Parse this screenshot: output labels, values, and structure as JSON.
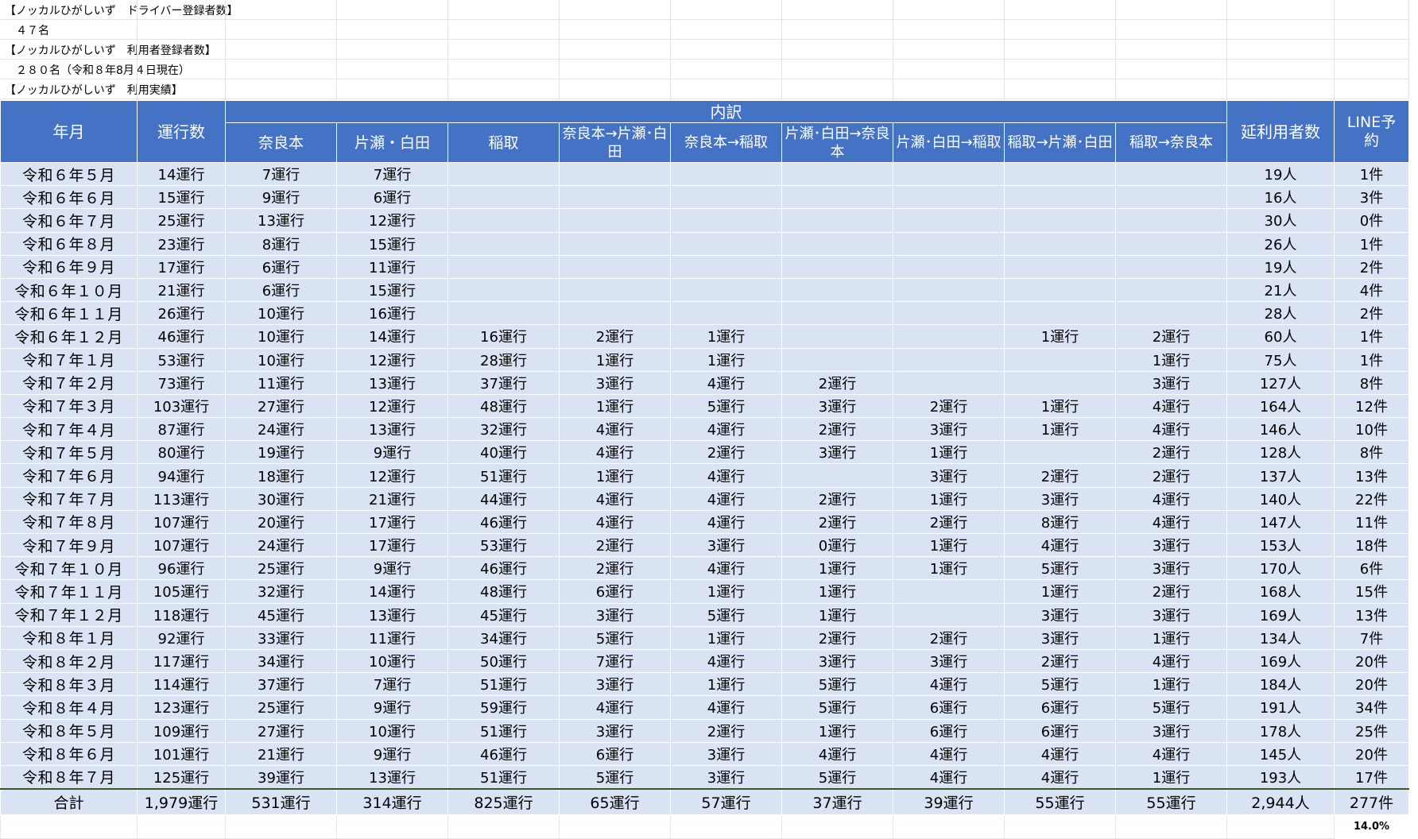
{
  "info": {
    "driver_label": "【ノッカルひがしいず　ドライバー登録者数】",
    "driver_value": "４７名",
    "user_label": "【ノッカルひがしいず　利用者登録者数】",
    "user_value": "２８０名（令和８年8月４日現在）",
    "results_label": "【ノッカルひがしいず　利用実績】"
  },
  "table": {
    "headers": {
      "year_month": "年月",
      "runs": "運行数",
      "breakdown": "内訳",
      "total_users": "延利用者数",
      "line_reservation": "LINE予約",
      "routes": [
        "奈良本",
        "片瀬・白田",
        "稲取",
        "奈良本→片瀬･白田",
        "奈良本→稲取",
        "片瀬･白田→奈良本",
        "片瀬･白田→稲取",
        "稲取→片瀬･白田",
        "稲取→奈良本"
      ]
    },
    "rows": [
      [
        "令和６年５月",
        "14運行",
        "7運行",
        "7運行",
        "",
        "",
        "",
        "",
        "",
        "",
        "",
        "19人",
        "1件"
      ],
      [
        "令和６年６月",
        "15運行",
        "9運行",
        "6運行",
        "",
        "",
        "",
        "",
        "",
        "",
        "",
        "16人",
        "3件"
      ],
      [
        "令和６年７月",
        "25運行",
        "13運行",
        "12運行",
        "",
        "",
        "",
        "",
        "",
        "",
        "",
        "30人",
        "0件"
      ],
      [
        "令和６年８月",
        "23運行",
        "8運行",
        "15運行",
        "",
        "",
        "",
        "",
        "",
        "",
        "",
        "26人",
        "1件"
      ],
      [
        "令和６年９月",
        "17運行",
        "6運行",
        "11運行",
        "",
        "",
        "",
        "",
        "",
        "",
        "",
        "19人",
        "2件"
      ],
      [
        "令和６年１０月",
        "21運行",
        "6運行",
        "15運行",
        "",
        "",
        "",
        "",
        "",
        "",
        "",
        "21人",
        "4件"
      ],
      [
        "令和６年１１月",
        "26運行",
        "10運行",
        "16運行",
        "",
        "",
        "",
        "",
        "",
        "",
        "",
        "28人",
        "2件"
      ],
      [
        "令和６年１２月",
        "46運行",
        "10運行",
        "14運行",
        "16運行",
        "2運行",
        "1運行",
        "",
        "",
        "1運行",
        "2運行",
        "60人",
        "1件"
      ],
      [
        "令和７年１月",
        "53運行",
        "10運行",
        "12運行",
        "28運行",
        "1運行",
        "1運行",
        "",
        "",
        "",
        "1運行",
        "75人",
        "1件"
      ],
      [
        "令和７年２月",
        "73運行",
        "11運行",
        "13運行",
        "37運行",
        "3運行",
        "4運行",
        "2運行",
        "",
        "",
        "3運行",
        "127人",
        "8件"
      ],
      [
        "令和７年３月",
        "103運行",
        "27運行",
        "12運行",
        "48運行",
        "1運行",
        "5運行",
        "3運行",
        "2運行",
        "1運行",
        "4運行",
        "164人",
        "12件"
      ],
      [
        "令和７年４月",
        "87運行",
        "24運行",
        "13運行",
        "32運行",
        "4運行",
        "4運行",
        "2運行",
        "3運行",
        "1運行",
        "4運行",
        "146人",
        "10件"
      ],
      [
        "令和７年５月",
        "80運行",
        "19運行",
        "9運行",
        "40運行",
        "4運行",
        "2運行",
        "3運行",
        "1運行",
        "",
        "2運行",
        "128人",
        "8件"
      ],
      [
        "令和７年６月",
        "94運行",
        "18運行",
        "12運行",
        "51運行",
        "1運行",
        "4運行",
        "",
        "3運行",
        "2運行",
        "2運行",
        "137人",
        "13件"
      ],
      [
        "令和７年７月",
        "113運行",
        "30運行",
        "21運行",
        "44運行",
        "4運行",
        "4運行",
        "2運行",
        "1運行",
        "3運行",
        "4運行",
        "140人",
        "22件"
      ],
      [
        "令和７年８月",
        "107運行",
        "20運行",
        "17運行",
        "46運行",
        "4運行",
        "4運行",
        "2運行",
        "2運行",
        "8運行",
        "4運行",
        "147人",
        "11件"
      ],
      [
        "令和７年９月",
        "107運行",
        "24運行",
        "17運行",
        "53運行",
        "2運行",
        "3運行",
        "0運行",
        "1運行",
        "4運行",
        "3運行",
        "153人",
        "18件"
      ],
      [
        "令和７年１０月",
        "96運行",
        "25運行",
        "9運行",
        "46運行",
        "2運行",
        "4運行",
        "1運行",
        "1運行",
        "5運行",
        "3運行",
        "170人",
        "6件"
      ],
      [
        "令和７年１１月",
        "105運行",
        "32運行",
        "14運行",
        "48運行",
        "6運行",
        "1運行",
        "1運行",
        "",
        "1運行",
        "2運行",
        "168人",
        "15件"
      ],
      [
        "令和７年１２月",
        "118運行",
        "45運行",
        "13運行",
        "45運行",
        "3運行",
        "5運行",
        "1運行",
        "",
        "3運行",
        "3運行",
        "169人",
        "13件"
      ],
      [
        "令和８年１月",
        "92運行",
        "33運行",
        "11運行",
        "34運行",
        "5運行",
        "1運行",
        "2運行",
        "2運行",
        "3運行",
        "1運行",
        "134人",
        "7件"
      ],
      [
        "令和８年２月",
        "117運行",
        "34運行",
        "10運行",
        "50運行",
        "7運行",
        "4運行",
        "3運行",
        "3運行",
        "2運行",
        "4運行",
        "169人",
        "20件"
      ],
      [
        "令和８年３月",
        "114運行",
        "37運行",
        "7運行",
        "51運行",
        "3運行",
        "1運行",
        "5運行",
        "4運行",
        "5運行",
        "1運行",
        "184人",
        "20件"
      ],
      [
        "令和８年４月",
        "123運行",
        "25運行",
        "9運行",
        "59運行",
        "4運行",
        "4運行",
        "5運行",
        "6運行",
        "6運行",
        "5運行",
        "191人",
        "34件"
      ],
      [
        "令和８年５月",
        "109運行",
        "27運行",
        "10運行",
        "51運行",
        "3運行",
        "2運行",
        "1運行",
        "6運行",
        "6運行",
        "3運行",
        "178人",
        "25件"
      ],
      [
        "令和８年６月",
        "101運行",
        "21運行",
        "9運行",
        "46運行",
        "6運行",
        "3運行",
        "4運行",
        "4運行",
        "4運行",
        "4運行",
        "145人",
        "20件"
      ],
      [
        "令和８年７月",
        "125運行",
        "39運行",
        "13運行",
        "51運行",
        "5運行",
        "3運行",
        "5運行",
        "4運行",
        "4運行",
        "1運行",
        "193人",
        "17件"
      ]
    ],
    "total": [
      "合計",
      "1,979運行",
      "531運行",
      "314運行",
      "825運行",
      "65運行",
      "57運行",
      "37運行",
      "39運行",
      "55運行",
      "55運行",
      "2,944人",
      "277件"
    ],
    "line_percentage": "14.0%"
  }
}
